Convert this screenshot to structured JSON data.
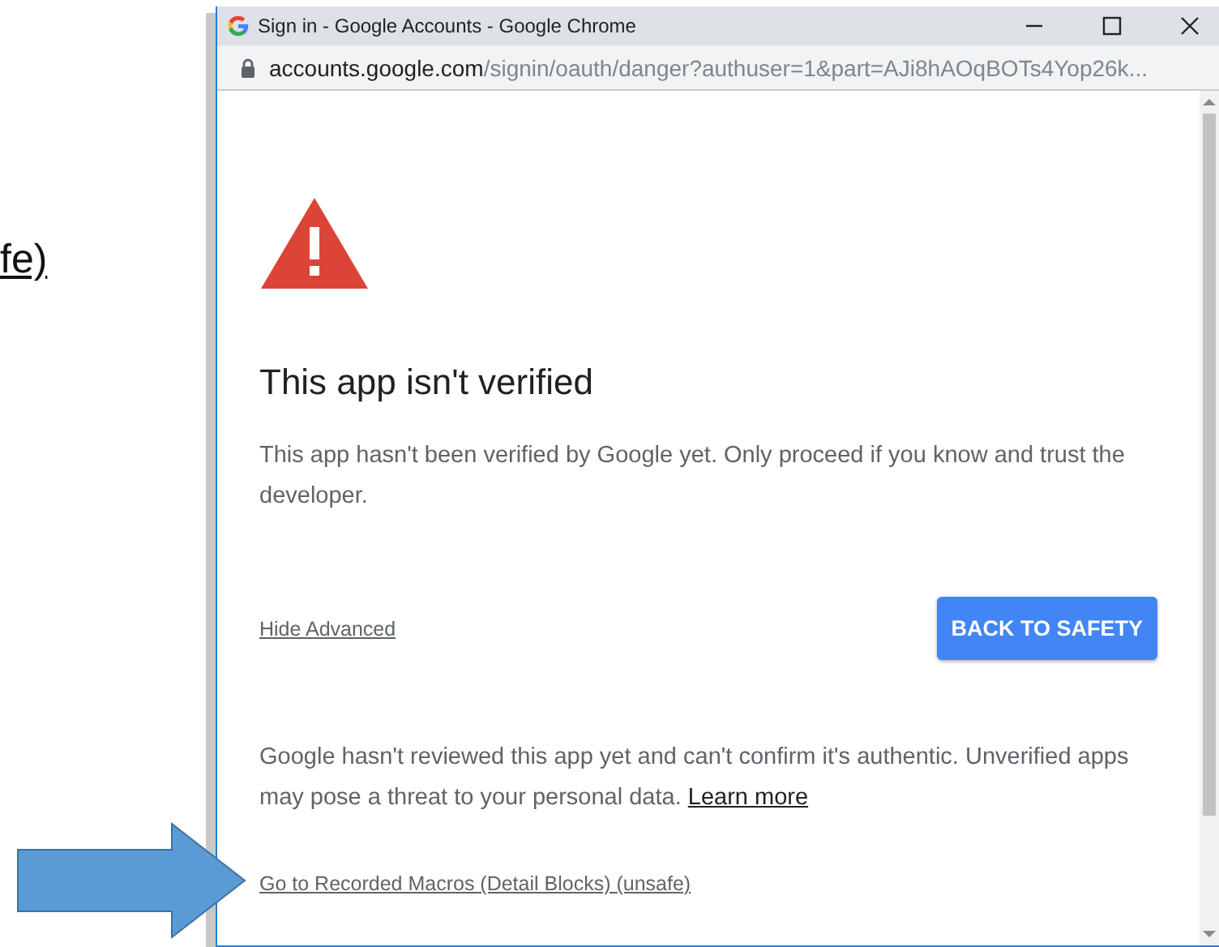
{
  "background_doc": {
    "link_fragment": "fe)"
  },
  "window": {
    "title": "Sign in - Google Accounts - Google Chrome",
    "url_host": "accounts.google.com",
    "url_path": "/signin/oauth/danger?authuser=1&part=AJi8hAOqBOTs4Yop26k..."
  },
  "page": {
    "heading": "This app isn't verified",
    "intro": "This app hasn't been verified by Google yet. Only proceed if you know and trust the developer.",
    "advanced_link": "Hide Advanced",
    "back_button": "BACK TO SAFETY",
    "details": "Google hasn't reviewed this app yet and can't confirm it's authentic. Unverified apps may pose a threat to your personal data.",
    "learn_more": "Learn more",
    "proceed_link": "Go to Recorded Macros (Detail Blocks) (unsafe)"
  }
}
